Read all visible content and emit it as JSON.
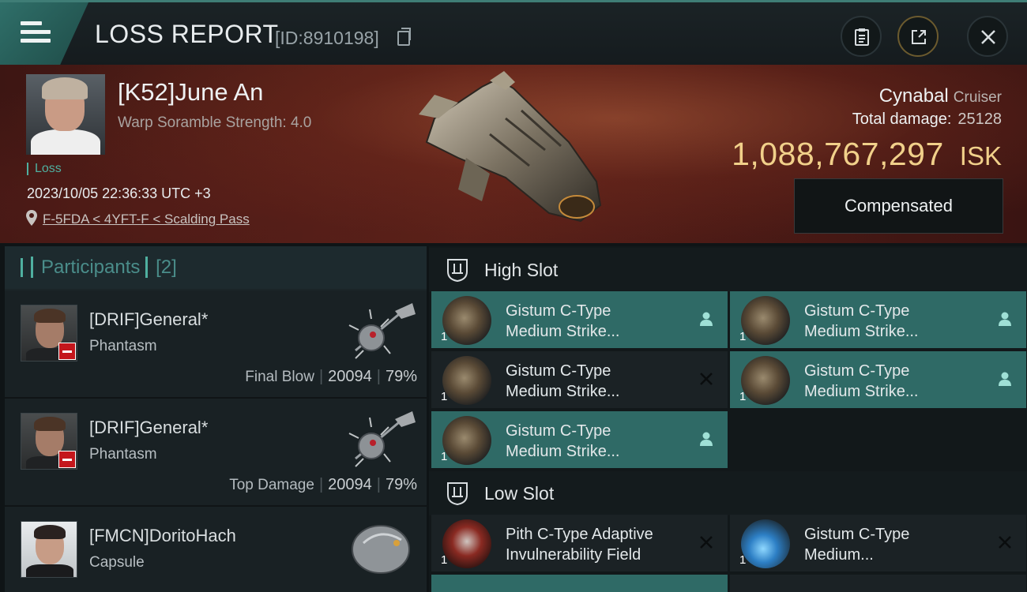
{
  "header": {
    "title": "LOSS REPORT",
    "report_id": "[ID:8910198]"
  },
  "victim": {
    "name": "[K52]June An",
    "scramble": "Warp Soramble Strength: 4.0",
    "loss_label": "Loss",
    "datetime": "2023/10/05 22:36:33 UTC +3",
    "location": "F-5FDA < 4YFT-F < Scalding Pass"
  },
  "ship": {
    "name": "Cynabal",
    "class": "Cruiser",
    "damage_label": "Total damage:",
    "damage_value": "25128",
    "isk_value": "1,088,767,297",
    "isk_unit": "ISK",
    "compensated_label": "Compensated"
  },
  "participants": {
    "title": "Participants",
    "count": "[2]",
    "items": [
      {
        "name": "[DRIF]General*",
        "ship": "Phantasm",
        "role": "Final Blow",
        "damage": "20094",
        "percent": "79%"
      },
      {
        "name": "[DRIF]General*",
        "ship": "Phantasm",
        "role": "Top Damage",
        "damage": "20094",
        "percent": "79%"
      },
      {
        "name": "[FMCN]DoritoHach",
        "ship": "Capsule"
      }
    ]
  },
  "high_slot": {
    "label": "High Slot",
    "modules": [
      {
        "line1": "Gistum C-Type",
        "line2": "Medium Strike...",
        "qty": "1",
        "status": "person-icon"
      },
      {
        "line1": "Gistum C-Type",
        "line2": "Medium Strike...",
        "qty": "1",
        "status": "person-icon"
      },
      {
        "line1": "Gistum C-Type",
        "line2": "Medium Strike...",
        "qty": "1",
        "status": "cross-icon"
      },
      {
        "line1": "Gistum C-Type",
        "line2": "Medium Strike...",
        "qty": "1",
        "status": "person-icon"
      },
      {
        "line1": "Gistum C-Type",
        "line2": "Medium Strike...",
        "qty": "1",
        "status": "person-icon"
      }
    ]
  },
  "low_slot": {
    "label": "Low Slot",
    "modules": [
      {
        "line1": "Pith C-Type Adaptive",
        "line2": "Invulnerability Field",
        "qty": "1",
        "status": "cross-icon"
      },
      {
        "line1": "Gistum C-Type",
        "line2": "Medium...",
        "qty": "1",
        "status": "cross-icon"
      }
    ]
  },
  "colors": {
    "accent": "#2f6a66",
    "isk_gold": "#f1d08a",
    "loss_green": "#4fb0a0"
  }
}
